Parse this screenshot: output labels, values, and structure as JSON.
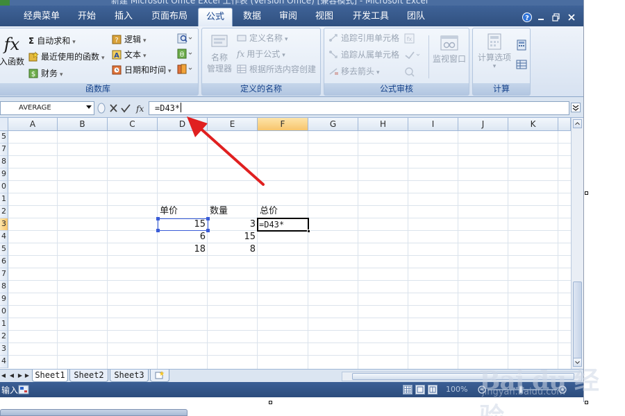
{
  "window": {
    "title": "新建 Microsoft Office Excel 工作表 (Version Office) [兼容模式] - Microsoft Excel"
  },
  "ribbon_tabs": [
    "经典菜单",
    "开始",
    "插入",
    "页面布局",
    "公式",
    "数据",
    "审阅",
    "视图",
    "开发工具",
    "团队"
  ],
  "active_tab": "公式",
  "ribbon": {
    "function_library": {
      "label": "函数库",
      "insert_function": "插入函数",
      "insert_function_visible": "入函数",
      "autosum": "自动求和",
      "recent": "最近使用的函数",
      "financial": "财务",
      "logical": "逻辑",
      "text": "文本",
      "datetime": "日期和时间"
    },
    "defined_names": {
      "label": "定义的名称",
      "name_manager_line1": "名称",
      "name_manager_line2": "管理器",
      "define_name": "定义名称",
      "use_in_formula": "用于公式",
      "create_from_selection": "根据所选内容创建"
    },
    "formula_auditing": {
      "label": "公式审核",
      "trace_precedents": "追踪引用单元格",
      "trace_dependents": "追踪从属单元格",
      "remove_arrows": "移去箭头",
      "watch_window": "监视窗口"
    },
    "calculation": {
      "label": "计算",
      "options": "计算选项"
    }
  },
  "formula_bar": {
    "name_box": "AVERAGE",
    "formula": "=D43*"
  },
  "grid": {
    "columns": [
      "A",
      "B",
      "C",
      "D",
      "E",
      "F",
      "G",
      "H",
      "I",
      "J",
      "K"
    ],
    "selected_column": "F",
    "rows": [
      "5",
      "7",
      "8",
      "9",
      "0",
      "1",
      "2",
      "3",
      "4",
      "5",
      "6",
      "7",
      "8",
      "9",
      "0",
      "1",
      "2",
      "3",
      "4"
    ],
    "selected_row_index": 7,
    "cells": {
      "d42": "单价",
      "e42": "数量",
      "f42": "总价",
      "d43": "15",
      "e43": "3",
      "f43": "=D43*",
      "d44": "6",
      "e44": "15",
      "d45": "18",
      "e45": "8"
    }
  },
  "sheets": [
    "Sheet1",
    "Sheet2",
    "Sheet3"
  ],
  "active_sheet": "Sheet1",
  "status": {
    "mode": "输入",
    "zoom": "100%"
  },
  "watermark": {
    "brand": "Bai du 经验",
    "site": "jingyan.baidu.com"
  },
  "colors": {
    "title_bar": "#3f6398",
    "ribbon_bg": "#dfe8f4",
    "reference_box": "#3a5cd8",
    "arrow": "#e02020",
    "selected_header": "#f7c56c"
  }
}
